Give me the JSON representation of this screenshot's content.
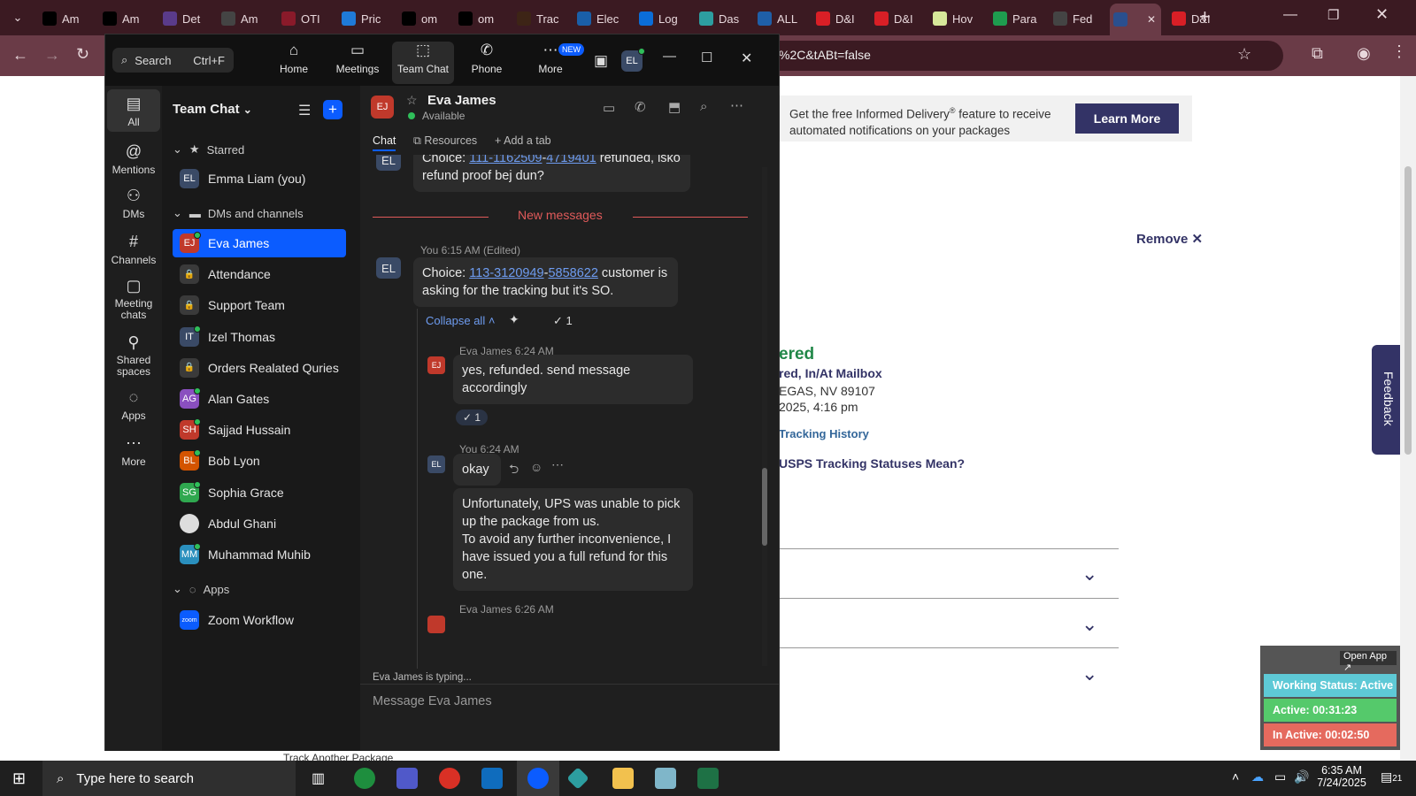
{
  "browser": {
    "tabs": [
      {
        "label": "Am",
        "icon": "amazon-icon",
        "color": "#000000"
      },
      {
        "label": "Am",
        "icon": "amazon-icon",
        "color": "#000000"
      },
      {
        "label": "Det",
        "icon": "list-icon",
        "color": "#5a3b8a"
      },
      {
        "label": "Am",
        "icon": "amazon-icon",
        "color": "#444444"
      },
      {
        "label": "OTI",
        "icon": "otis-icon",
        "color": "#8a1a2a"
      },
      {
        "label": "Pric",
        "icon": "price-icon",
        "color": "#1f7ad8"
      },
      {
        "label": "om",
        "icon": "triangle-icon",
        "color": "#000000"
      },
      {
        "label": "om",
        "icon": "triangle-icon",
        "color": "#000000"
      },
      {
        "label": "Trac",
        "icon": "ups-icon",
        "color": "#3d2416"
      },
      {
        "label": "Elec",
        "icon": "ec-icon",
        "color": "#1a5fa8"
      },
      {
        "label": "Log",
        "icon": "login-icon",
        "color": "#0b6dd8"
      },
      {
        "label": "Das",
        "icon": "dash-icon",
        "color": "#2d9ea0"
      },
      {
        "label": "ALL",
        "icon": "seventeen-icon",
        "color": "#1f5fa8"
      },
      {
        "label": "D&I",
        "icon": "dh-icon",
        "color": "#d81f26"
      },
      {
        "label": "D&I",
        "icon": "dh-icon",
        "color": "#d81f26"
      },
      {
        "label": "Hov",
        "icon": "circle-icon",
        "color": "#d7e89a"
      },
      {
        "label": "Para",
        "icon": "sheets-icon",
        "color": "#1e9c4f"
      },
      {
        "label": "Fed",
        "icon": "openai-icon",
        "color": "#444444"
      },
      {
        "label": "",
        "icon": "usps-icon",
        "color": "#2a4f8e"
      },
      {
        "label": "D&I",
        "icon": "dh-icon",
        "color": "#d81f26"
      }
    ],
    "url_tail": "%2C&tABt=false"
  },
  "usps": {
    "banner_text": "Get the free Informed Delivery",
    "banner_sup": "®",
    "banner_text2": " feature to receive",
    "banner_text3": "automated notifications on your packages",
    "learn_more": "Learn More",
    "remove": "Remove",
    "status": "ered",
    "status_line2": "red, In/At Mailbox",
    "city": "EGAS, NV 89107",
    "date": "2025, 4:16 pm",
    "history_link": "Tracking History",
    "statuses_link": "USPS Tracking Statuses Mean?",
    "feedback": "Feedback",
    "cut_off_text": "Track Another Package"
  },
  "widget": {
    "open_app": "Open App ↗",
    "working_status": "Working Status: Active",
    "active": "Active: 00:31:23",
    "inactive": "In Active: 00:02:50"
  },
  "zoom": {
    "search_label": "Search",
    "search_shortcut": "Ctrl+F",
    "tabs": [
      "Home",
      "Meetings",
      "Team Chat",
      "Phone",
      "More"
    ],
    "new_badge": "NEW",
    "user_initials": "EL",
    "rail": [
      "All",
      "Mentions",
      "DMs",
      "Channels",
      "Meeting chats",
      "Shared spaces",
      "Apps",
      "More"
    ],
    "sidebar_title": "Team Chat",
    "starred_header": "Starred",
    "starred": [
      {
        "initials": "EL",
        "name": "Emma Liam (you)",
        "color": "#3a4a66"
      }
    ],
    "dms_header": "DMs and channels",
    "dms": [
      {
        "initials": "EJ",
        "name": "Eva James",
        "color": "#c0392b",
        "kind": "person",
        "online": true
      },
      {
        "initials": "",
        "name": "Attendance",
        "color": "#3a3a3a",
        "kind": "channel",
        "online": false
      },
      {
        "initials": "",
        "name": "Support Team",
        "color": "#3a3a3a",
        "kind": "channel",
        "online": false
      },
      {
        "initials": "IT",
        "name": "Izel Thomas",
        "color": "#3a4a66",
        "kind": "person",
        "online": true
      },
      {
        "initials": "",
        "name": "Orders Realated Quries",
        "color": "#3a3a3a",
        "kind": "channel",
        "online": false
      },
      {
        "initials": "AG",
        "name": "Alan Gates",
        "color": "#8a4fbf",
        "kind": "person",
        "online": true
      },
      {
        "initials": "SH",
        "name": "Sajjad Hussain",
        "color": "#c0392b",
        "kind": "person",
        "online": true
      },
      {
        "initials": "BL",
        "name": "Bob Lyon",
        "color": "#d35400",
        "kind": "person",
        "online": true
      },
      {
        "initials": "SG",
        "name": "Sophia Grace",
        "color": "#2fa84f",
        "kind": "person",
        "online": true
      },
      {
        "initials": "",
        "name": "Abdul Ghani",
        "color": "#cccccc",
        "kind": "photo",
        "online": false
      },
      {
        "initials": "MM",
        "name": "Muhammad Muhib",
        "color": "#2a8fbd",
        "kind": "person",
        "online": true
      }
    ],
    "apps_header": "Apps",
    "apps": [
      {
        "initials": "zoom",
        "name": "Zoom Workflow",
        "color": "#0b5cff"
      }
    ],
    "chat": {
      "contact_initials": "EJ",
      "contact_name": "Eva James",
      "contact_status": "Available",
      "tabs": [
        "Chat",
        "Resources",
        "Add a tab"
      ],
      "prev_initials": "EL",
      "prev_msg_prefix": "Choice: ",
      "prev_link1": "111-1162509",
      "prev_dash": "-",
      "prev_link2": "4719401",
      "prev_msg_suffix": " refunded, isko",
      "prev_msg_line2": "refund proof bej dun?",
      "new_messages": "New messages",
      "msg1_meta": "You 6:15 AM (Edited)",
      "msg1_initials": "EL",
      "msg1_prefix": "Choice: ",
      "msg1_link1": "113-3120949",
      "msg1_dash": "-",
      "msg1_link2": "5858622",
      "msg1_suffix": " customer is",
      "msg1_line2": "asking for the tracking but it's SO.",
      "collapse_all": "Collapse all",
      "check_count": "1",
      "reply1_meta": "Eva James 6:24 AM",
      "reply1_initials": "EJ",
      "reply1_text": "yes, refunded. send message accordingly",
      "reply1_react": "1",
      "reply2_meta": "You 6:24 AM",
      "reply2_initials": "EL",
      "reply2_text": "okay",
      "reply3_text_1": "Unfortunately, UPS was unable to pick up the package from us.",
      "reply3_text_2": "To avoid any further inconvenience, I have issued you a full refund for this one.",
      "reply4_meta": "Eva James 6:26 AM",
      "typing": "Eva James  is typing...",
      "composer_placeholder": "Message Eva James",
      "composer_icons": [
        "format-icon",
        "emoji-icon",
        "gif-icon",
        "file-icon",
        "screenshot-icon",
        "mic-icon",
        "video-icon",
        "code-icon",
        "more-icon"
      ]
    }
  },
  "taskbar": {
    "search_placeholder": "Type here to search",
    "time": "6:35 AM",
    "date": "7/24/2025",
    "notifications": "21"
  }
}
